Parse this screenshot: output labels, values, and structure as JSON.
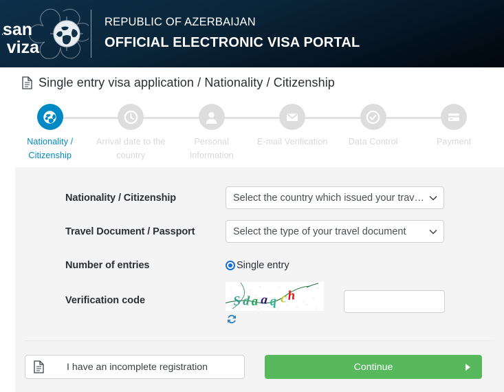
{
  "header": {
    "logo_text_top": "asan",
    "logo_text_bottom": "viza",
    "line1": "REPUBLIC OF AZERBAIJAN",
    "line2": "OFFICIAL ELECTRONIC VISA PORTAL",
    "gradient_from": "#0d2f49",
    "gradient_to": "#01070d"
  },
  "breadcrumb": {
    "icon": "document-icon",
    "text": "Single entry visa application / Nationality / Citizenship"
  },
  "stepper": {
    "active_color": "#0089c4",
    "inactive_color": "#dddddd",
    "steps": [
      {
        "icon": "globe-icon",
        "label": "Nationality / Citizenship",
        "active": true
      },
      {
        "icon": "clock-icon",
        "label": "Arrival date to the country",
        "active": false
      },
      {
        "icon": "person-icon",
        "label": "Personal Information",
        "active": false
      },
      {
        "icon": "envelope-icon",
        "label": "E-mail Verification",
        "active": false
      },
      {
        "icon": "check-circle-icon",
        "label": "Data Control",
        "active": false
      },
      {
        "icon": "credit-card-icon",
        "label": "Payment",
        "active": false
      }
    ]
  },
  "form": {
    "nationality": {
      "label": "Nationality / Citizenship",
      "selected": "Select the country which issued your travel document"
    },
    "travel_document": {
      "label": "Travel Document / Passport",
      "selected": "Select the type of your travel document"
    },
    "entries": {
      "label": "Number of entries",
      "option_label": "Single entry",
      "radio_color": "#1a6fd4"
    },
    "verification": {
      "label": "Verification code",
      "captcha_characters": "Sdaaqch",
      "captcha_colors": [
        "#3a9e9e",
        "#3aa17f",
        "#26a65b",
        "#2b1a7a",
        "#38b09a",
        "#c8c832",
        "#e01b1b"
      ],
      "refresh_icon": "refresh-icon",
      "input_value": "",
      "input_placeholder": ""
    }
  },
  "footer": {
    "incomplete_icon": "document-icon",
    "incomplete_label": "I have an incomplete registration",
    "continue_label": "Continue",
    "continue_color": "#57b85c"
  }
}
